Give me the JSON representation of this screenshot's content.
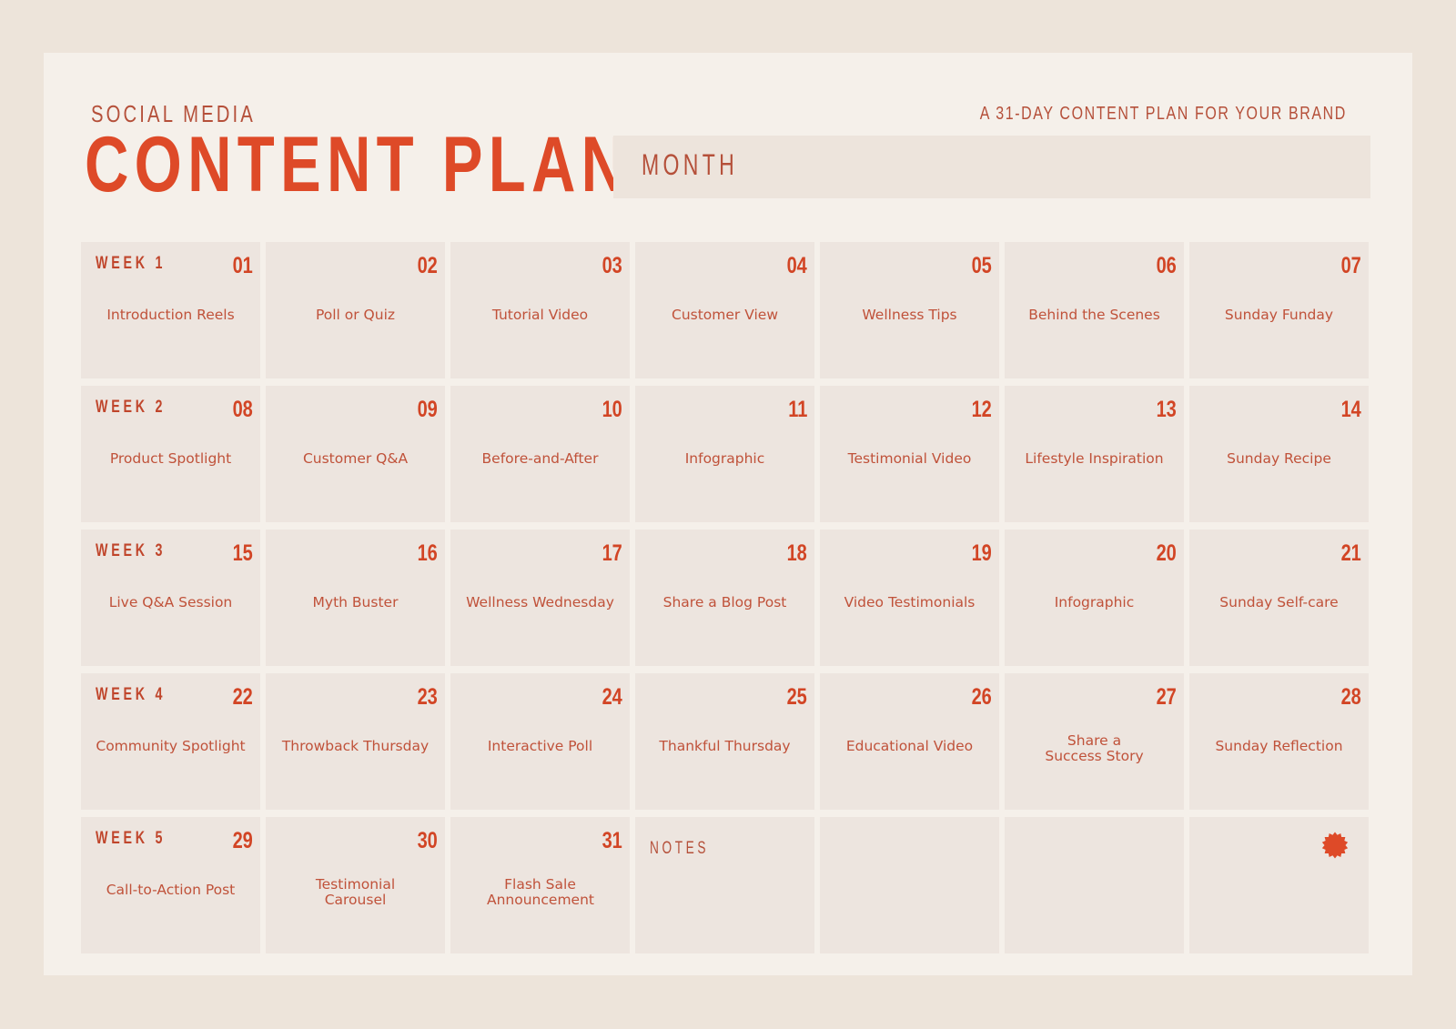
{
  "header": {
    "subtitle": "SOCIAL MEDIA",
    "title": "CONTENT PLAN",
    "tagline": "A 31-DAY CONTENT PLAN FOR YOUR BRAND",
    "month_label": "MONTH"
  },
  "colors": {
    "accent": "#de4a28",
    "text": "#c0523a",
    "cell_bg": "#ede5df",
    "page_bg": "#f5f0ea",
    "outer_bg": "#ede4da"
  },
  "weeks": [
    {
      "label": "WEEK 1",
      "days": [
        {
          "day": "01",
          "topic": "Introduction Reels"
        },
        {
          "day": "02",
          "topic": "Poll or Quiz"
        },
        {
          "day": "03",
          "topic": "Tutorial Video"
        },
        {
          "day": "04",
          "topic": "Customer View"
        },
        {
          "day": "05",
          "topic": "Wellness Tips"
        },
        {
          "day": "06",
          "topic": "Behind the Scenes"
        },
        {
          "day": "07",
          "topic": "Sunday Funday"
        }
      ]
    },
    {
      "label": "WEEK 2",
      "days": [
        {
          "day": "08",
          "topic": "Product Spotlight"
        },
        {
          "day": "09",
          "topic": "Customer Q&A"
        },
        {
          "day": "10",
          "topic": "Before-and-After"
        },
        {
          "day": "11",
          "topic": "Infographic"
        },
        {
          "day": "12",
          "topic": "Testimonial Video"
        },
        {
          "day": "13",
          "topic": "Lifestyle Inspiration"
        },
        {
          "day": "14",
          "topic": "Sunday Recipe"
        }
      ]
    },
    {
      "label": "WEEK 3",
      "days": [
        {
          "day": "15",
          "topic": "Live Q&A Session"
        },
        {
          "day": "16",
          "topic": "Myth Buster"
        },
        {
          "day": "17",
          "topic": "Wellness Wednesday"
        },
        {
          "day": "18",
          "topic": "Share a Blog Post"
        },
        {
          "day": "19",
          "topic": "Video Testimonials"
        },
        {
          "day": "20",
          "topic": "Infographic"
        },
        {
          "day": "21",
          "topic": "Sunday Self-care"
        }
      ]
    },
    {
      "label": "WEEK 4",
      "days": [
        {
          "day": "22",
          "topic": "Community Spotlight"
        },
        {
          "day": "23",
          "topic": "Throwback Thursday"
        },
        {
          "day": "24",
          "topic": "Interactive Poll"
        },
        {
          "day": "25",
          "topic": "Thankful Thursday"
        },
        {
          "day": "26",
          "topic": "Educational Video"
        },
        {
          "day": "27",
          "topic": "Share a Success Story"
        },
        {
          "day": "28",
          "topic": "Sunday Reflection"
        }
      ]
    },
    {
      "label": "WEEK 5",
      "days": [
        {
          "day": "29",
          "topic": "Call-to-Action Post"
        },
        {
          "day": "30",
          "topic": "Testimonial Carousel"
        },
        {
          "day": "31",
          "topic": "Flash Sale Announcement"
        }
      ]
    }
  ],
  "notes": {
    "label": "NOTES"
  },
  "decoration": {
    "icon": "starburst-icon"
  }
}
